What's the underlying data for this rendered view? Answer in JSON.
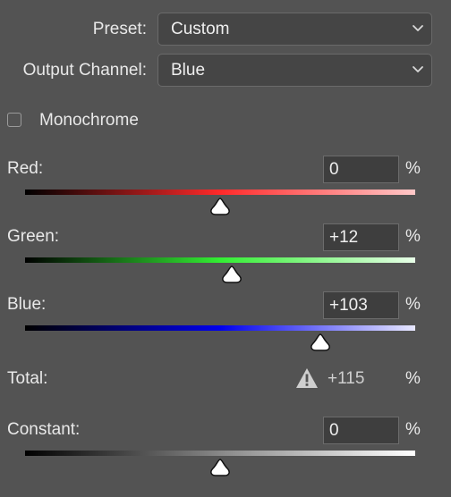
{
  "preset": {
    "label": "Preset:",
    "value": "Custom"
  },
  "output_channel": {
    "label": "Output Channel:",
    "value": "Blue"
  },
  "monochrome": {
    "label": "Monochrome",
    "checked": false
  },
  "sliders": {
    "red": {
      "label": "Red:",
      "value": "0",
      "unit": "%",
      "level": 0
    },
    "green": {
      "label": "Green:",
      "value": "+12",
      "unit": "%",
      "level": 12
    },
    "blue": {
      "label": "Blue:",
      "value": "+103",
      "unit": "%",
      "level": 103
    },
    "constant": {
      "label": "Constant:",
      "value": "0",
      "unit": "%",
      "level": 0
    }
  },
  "slider_range": [
    -200,
    200
  ],
  "total": {
    "label": "Total:",
    "value": "+115",
    "unit": "%",
    "icon": "warning-icon"
  },
  "colors": {
    "background": "#535353",
    "red_track": "#ff3333",
    "green_track": "#33ff33",
    "blue_track": "#0000ff"
  }
}
